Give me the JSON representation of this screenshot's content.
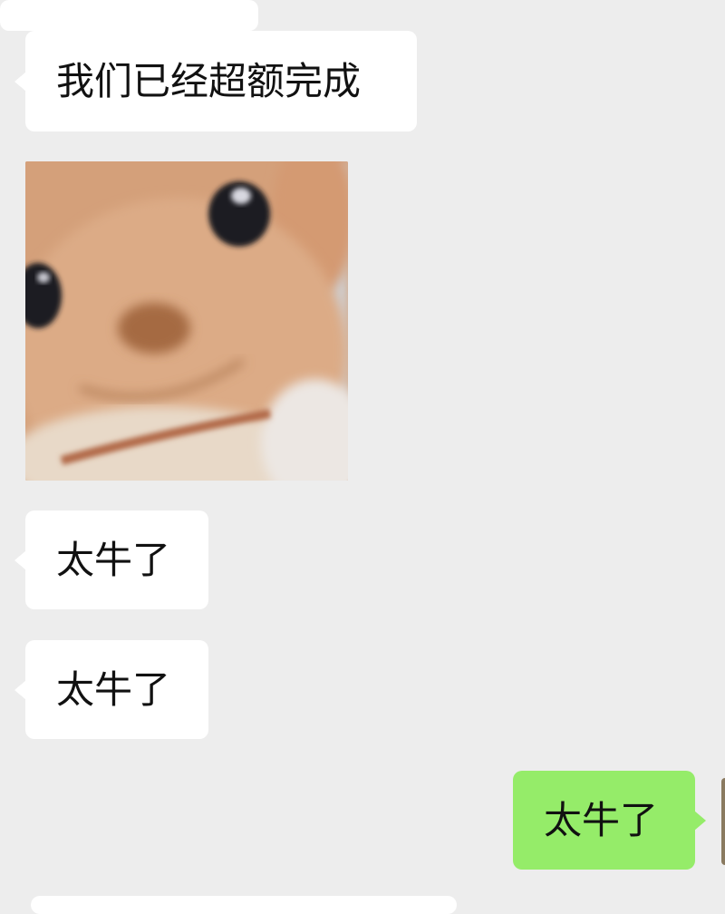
{
  "chat": {
    "messages": [
      {
        "side": "incoming",
        "type": "text",
        "text": "我们已经超额完成"
      },
      {
        "side": "incoming",
        "type": "image",
        "icon": "puppy-sticker-image"
      },
      {
        "side": "incoming",
        "type": "text",
        "text": "太牛了"
      },
      {
        "side": "incoming",
        "type": "text",
        "text": "太牛了"
      },
      {
        "side": "outgoing",
        "type": "text",
        "text": "太牛了"
      }
    ]
  },
  "colors": {
    "background": "#ededed",
    "incoming_bubble": "#ffffff",
    "outgoing_bubble": "#95ec69",
    "text": "#111111"
  }
}
